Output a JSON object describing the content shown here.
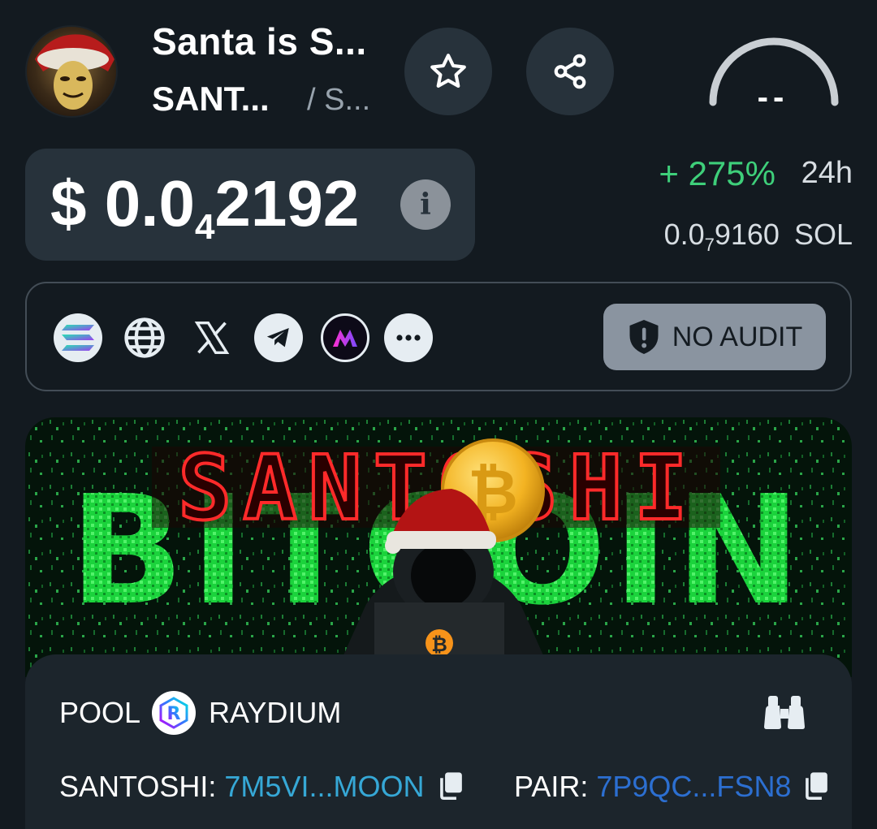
{
  "header": {
    "token_name": "Santa is S...",
    "token_symbol": "SANT...",
    "token_chain": "/ S...",
    "gauge_value": "--"
  },
  "price": {
    "usd_prefix": "$ 0.0",
    "usd_zeros_subscript": "4",
    "usd_digits": "2192",
    "change": "+ 275%",
    "change_period": "24h",
    "sol_prefix": "0.0",
    "sol_zeros_subscript": "7",
    "sol_digits": "9160",
    "sol_unit": "SOL"
  },
  "links": {
    "icons": [
      "solana-icon",
      "globe-icon",
      "x-icon",
      "telegram-icon",
      "app-icon",
      "more-icon"
    ],
    "audit_label": "NO AUDIT"
  },
  "banner": {
    "title_top": "SANTOSHI",
    "title_bottom": "BITCOIN",
    "coin_symbol": "₿"
  },
  "pool": {
    "label": "POOL",
    "dex_name": "RAYDIUM",
    "token_label": "SANTOSHI:",
    "token_address": "7M5VI...MOON",
    "pair_label": "PAIR:",
    "pair_address": "7P9QC...FSN8"
  },
  "colors": {
    "background": "#131a20",
    "card": "#27323b",
    "positive": "#3ecf7a",
    "link": "#36a8d6"
  }
}
